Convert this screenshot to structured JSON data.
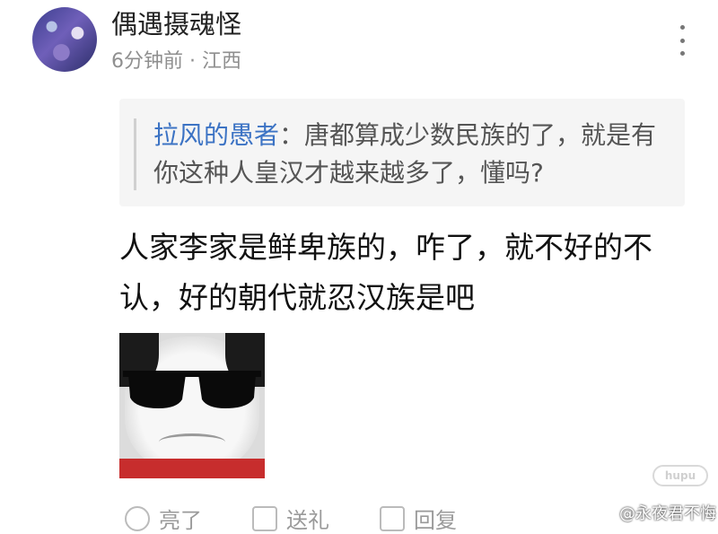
{
  "post": {
    "author": "偶遇摄魂怪",
    "meta": "6分钟前 · 江西",
    "quote": {
      "author": "拉风的愚者",
      "separator": "：",
      "text": "唐都算成少数民族的了，就是有你这种人皇汉才越来越多了，懂吗?"
    },
    "body": "人家李家是鲜卑族的，咋了，就不好的不认，好的朝代就忍汉族是吧"
  },
  "toolbar": {
    "like": "亮了",
    "gift": "送礼",
    "reply": "回复"
  },
  "watermark": {
    "badge": "hupu",
    "text": "@永夜君不悔"
  },
  "icons": {
    "more": "more-vertical-icon",
    "like": "lightning-icon",
    "gift": "gift-icon",
    "reply": "edit-icon"
  }
}
